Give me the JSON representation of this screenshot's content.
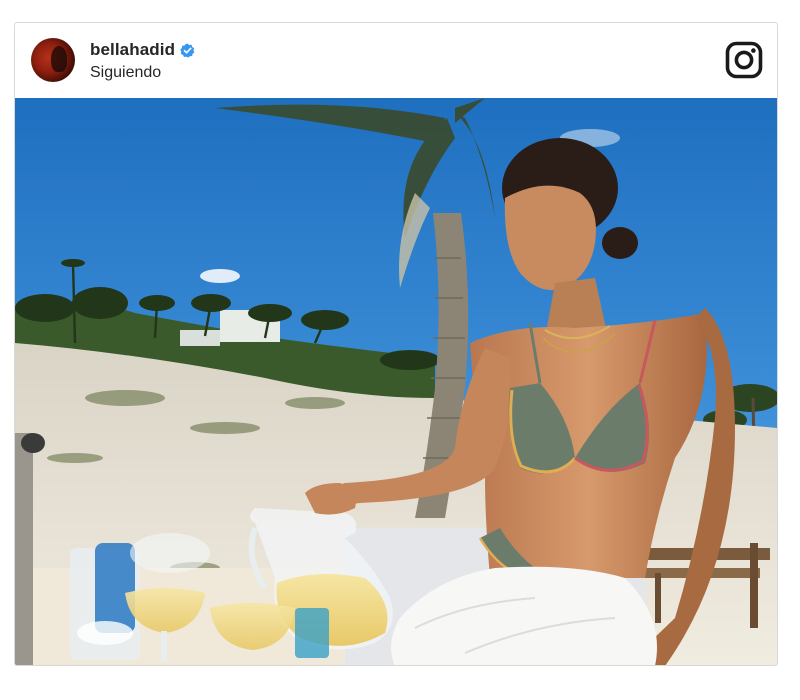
{
  "post": {
    "username": "bellahadid",
    "follow_status": "Siguiendo"
  },
  "icons": {
    "verified": "verified-badge-icon",
    "platform": "instagram-icon"
  },
  "colors": {
    "verified_blue": "#3897f0",
    "text": "#262626",
    "border": "#d8d8d8"
  }
}
